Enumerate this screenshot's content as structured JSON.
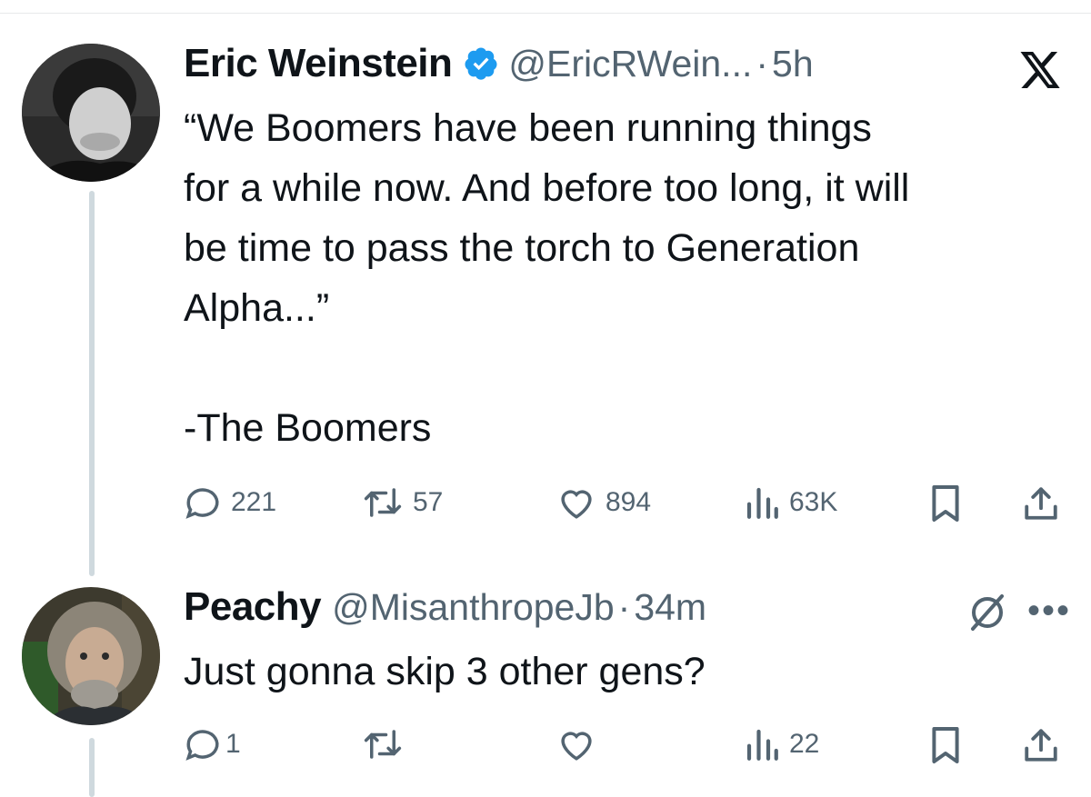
{
  "tweet": {
    "author_name": "Eric Weinstein",
    "handle": "@EricRWein...",
    "separator": "·",
    "time": "5h",
    "verified": true,
    "body": [
      "“We Boomers have been running things",
      "for a while now. And before too long, it will",
      "be time to pass the torch to Generation",
      "Alpha...”",
      "",
      "-The Boomers"
    ],
    "stats": {
      "replies": "221",
      "reposts": "57",
      "likes": "894",
      "views": "63K"
    }
  },
  "reply": {
    "author_name": "Peachy",
    "handle": "@MisanthropeJb",
    "separator": "·",
    "time": "34m",
    "body": "Just gonna skip 3 other gens?",
    "stats": {
      "replies": "1",
      "reposts": "",
      "likes": "",
      "views": "22"
    }
  },
  "icons": {
    "reply": "speech-bubble-icon",
    "repost": "repost-arrows-icon",
    "like": "heart-icon",
    "views": "bar-chart-icon",
    "bookmark": "bookmark-icon",
    "share": "share-upload-icon",
    "brand": "x-logo-icon",
    "more": "more-dots-icon",
    "grok": "grok-slash-icon"
  },
  "colors": {
    "verified_blue": "#1d9bf0",
    "muted_text": "#536471",
    "thread_line": "#cfd9de"
  }
}
